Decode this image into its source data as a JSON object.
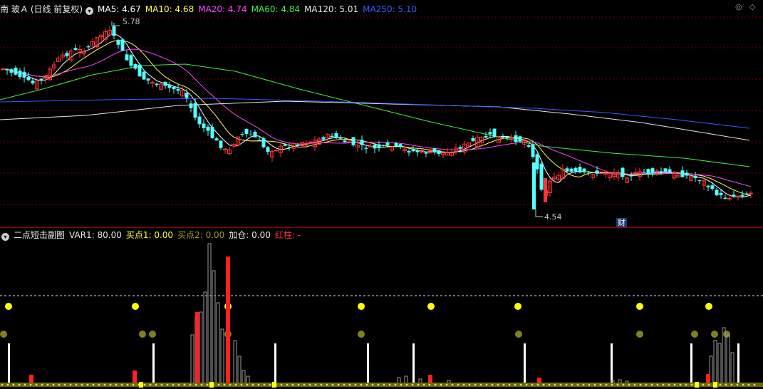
{
  "header": {
    "stock_name": "南 玻Ａ",
    "period": "(日线 前复权)",
    "ma": [
      {
        "label": "MA5: 4.67",
        "color": "#ffffff"
      },
      {
        "label": "MA10: 4.68",
        "color": "#ffff55"
      },
      {
        "label": "MA20: 4.74",
        "color": "#ff44ff"
      },
      {
        "label": "MA60: 4.84",
        "color": "#44ee44"
      },
      {
        "label": "MA120: 5.01",
        "color": "#e6e6e6"
      },
      {
        "label": "MA250: 5.10",
        "color": "#3a5aff"
      }
    ],
    "icon_top_right_1": "◎",
    "icon_top_right_2": "◇"
  },
  "annotations": {
    "high_label": "5.78",
    "low_label": "4.54",
    "fin_badge": "财"
  },
  "indicator": {
    "title": "二点短击副图",
    "fields": [
      {
        "label": "VAR1: 80.00",
        "color": "#e8e8e8"
      },
      {
        "label": "买点1: 0.00",
        "color": "#ffff33"
      },
      {
        "label": "买点2: 0.00",
        "color": "#9b9b2f"
      },
      {
        "label": "加仓: 0.00",
        "color": "#e8e8e8"
      },
      {
        "label": "红柱: -",
        "color": "#ff3333"
      }
    ]
  },
  "colors": {
    "up": "#ff3333",
    "down": "#54ffff",
    "grid": "#7a0000",
    "separator": "#a00000"
  }
}
